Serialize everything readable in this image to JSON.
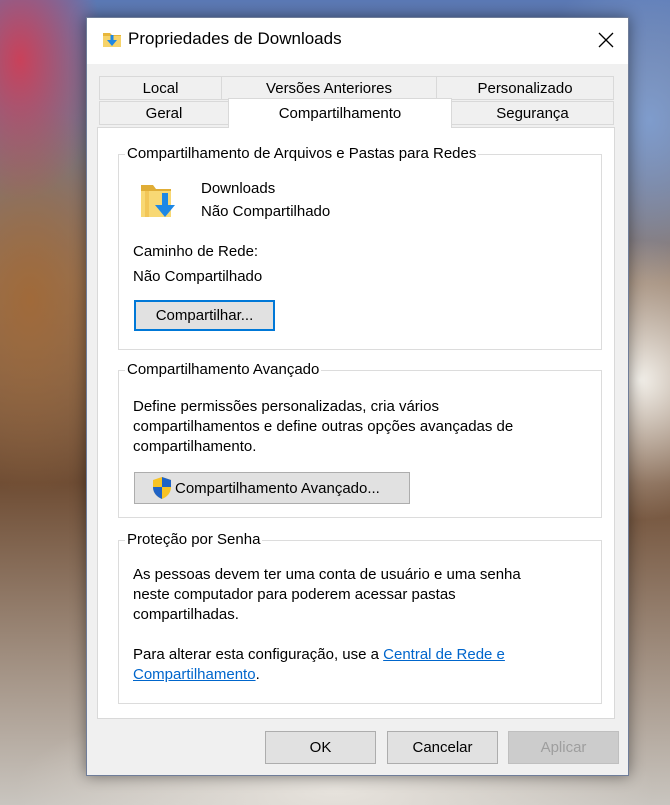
{
  "window": {
    "title": "Propriedades de Downloads",
    "close_icon": "close-icon"
  },
  "tabs": {
    "row1": [
      "Local",
      "Versões Anteriores",
      "Personalizado"
    ],
    "row2": [
      "Geral",
      "Compartilhamento",
      "Segurança"
    ],
    "active": "Compartilhamento"
  },
  "network_sharing": {
    "group_title": "Compartilhamento de Arquivos e Pastas para Redes",
    "folder_name": "Downloads",
    "folder_status": "Não Compartilhado",
    "path_label": "Caminho de Rede:",
    "path_value": "Não Compartilhado",
    "share_button": "Compartilhar..."
  },
  "advanced_sharing": {
    "group_title": "Compartilhamento Avançado",
    "description": "Define permissões personalizadas, cria vários compartilhamentos e define outras opções avançadas de compartilhamento.",
    "description_lines": [
      "Define permissões personalizadas, cria vários",
      "compartilhamentos e define outras opções avançadas de",
      "compartilhamento."
    ],
    "button": "Compartilhamento Avançado..."
  },
  "password_protection": {
    "group_title": "Proteção por Senha",
    "description_lines": [
      "As pessoas devem ter uma conta de usuário e uma senha",
      "neste computador para poderem acessar pastas",
      "compartilhadas."
    ],
    "change_text": "Para alterar esta configuração, use a",
    "link_line1": "Central de Rede e",
    "link_line2": "Compartilhamento",
    "period": "."
  },
  "footer": {
    "ok": "OK",
    "cancel": "Cancelar",
    "apply": "Aplicar"
  },
  "colors": {
    "accent": "#0078d7",
    "link": "#0066cc",
    "folder": "#f3c74e",
    "arrow": "#1e88e5"
  }
}
